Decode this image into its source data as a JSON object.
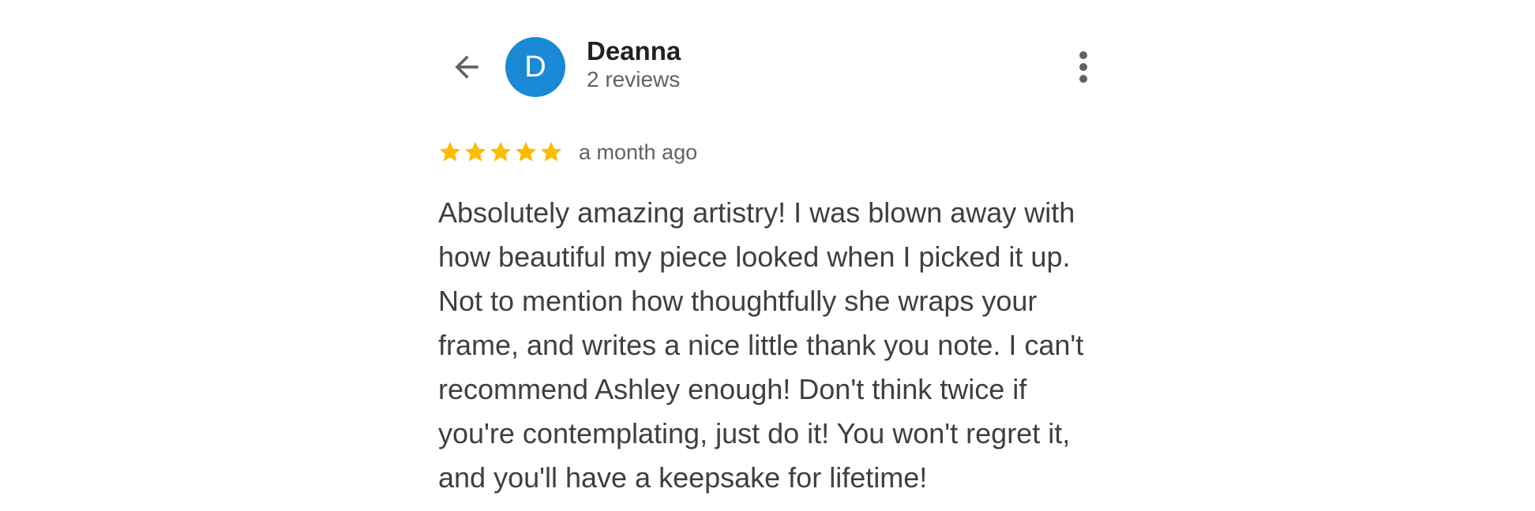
{
  "header": {
    "back_icon": "arrow-left-icon",
    "avatar_letter": "D",
    "avatar_color": "#1a8ad6",
    "user_name": "Deanna",
    "review_count": "2 reviews",
    "more_icon": "more-vertical-icon"
  },
  "review": {
    "rating": 5,
    "rating_max": 5,
    "star_color": "#fbbc04",
    "date": "a month ago",
    "text": "Absolutely amazing artistry! I was blown away with how beautiful my piece looked when I picked it up. Not to mention how thoughtfully she wraps your frame, and writes a nice little thank you note. I can't recommend Ashley enough! Don't think twice if you're contemplating, just do it! You won't regret it, and you'll have a keepsake for lifetime!"
  }
}
